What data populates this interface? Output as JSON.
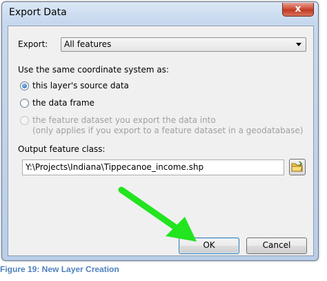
{
  "window": {
    "title": "Export Data",
    "close_label": "x"
  },
  "export": {
    "label": "Export:",
    "selected": "All features"
  },
  "coordinate": {
    "heading": "Use the same coordinate system as:",
    "options": [
      {
        "label": "this layer's source data",
        "checked": true,
        "disabled": false
      },
      {
        "label": "the data frame",
        "checked": false,
        "disabled": false
      },
      {
        "label": "the feature dataset you export the data into",
        "sub": "(only applies if you export to a feature dataset in a geodatabase)",
        "checked": false,
        "disabled": true
      }
    ]
  },
  "output": {
    "label": "Output feature class:",
    "value": "Y:\\Projects\\Indiana\\Tippecanoe_income.shp"
  },
  "buttons": {
    "ok": "OK",
    "cancel": "Cancel"
  },
  "caption": "Figure 19: New Layer Creation",
  "colors": {
    "arrow": "#22e41f",
    "caption": "#4f81bd"
  }
}
